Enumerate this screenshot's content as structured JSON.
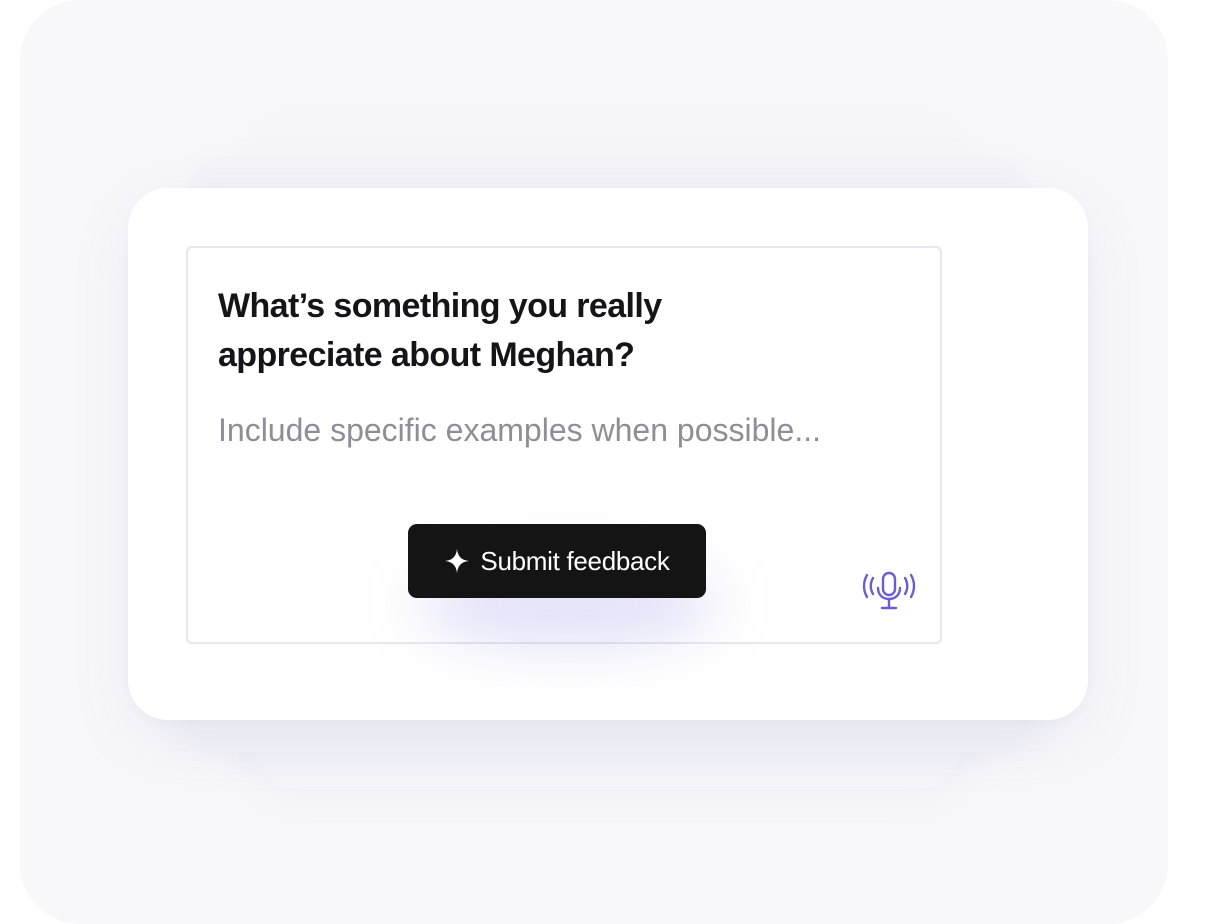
{
  "feedback": {
    "question": "What’s something you really appreciate about Meghan?",
    "answer_value": "",
    "answer_placeholder": "Include specific examples when possible...",
    "submit_label": "Submit feedback",
    "submit_icon": "sparkle-icon",
    "voice_icon": "microphone-broadcast-icon"
  },
  "colors": {
    "button_bg": "#141414",
    "button_text": "#ffffff",
    "accent": "#6a5fd0",
    "placeholder": "#8e8e98",
    "border": "#e7e7f2"
  }
}
